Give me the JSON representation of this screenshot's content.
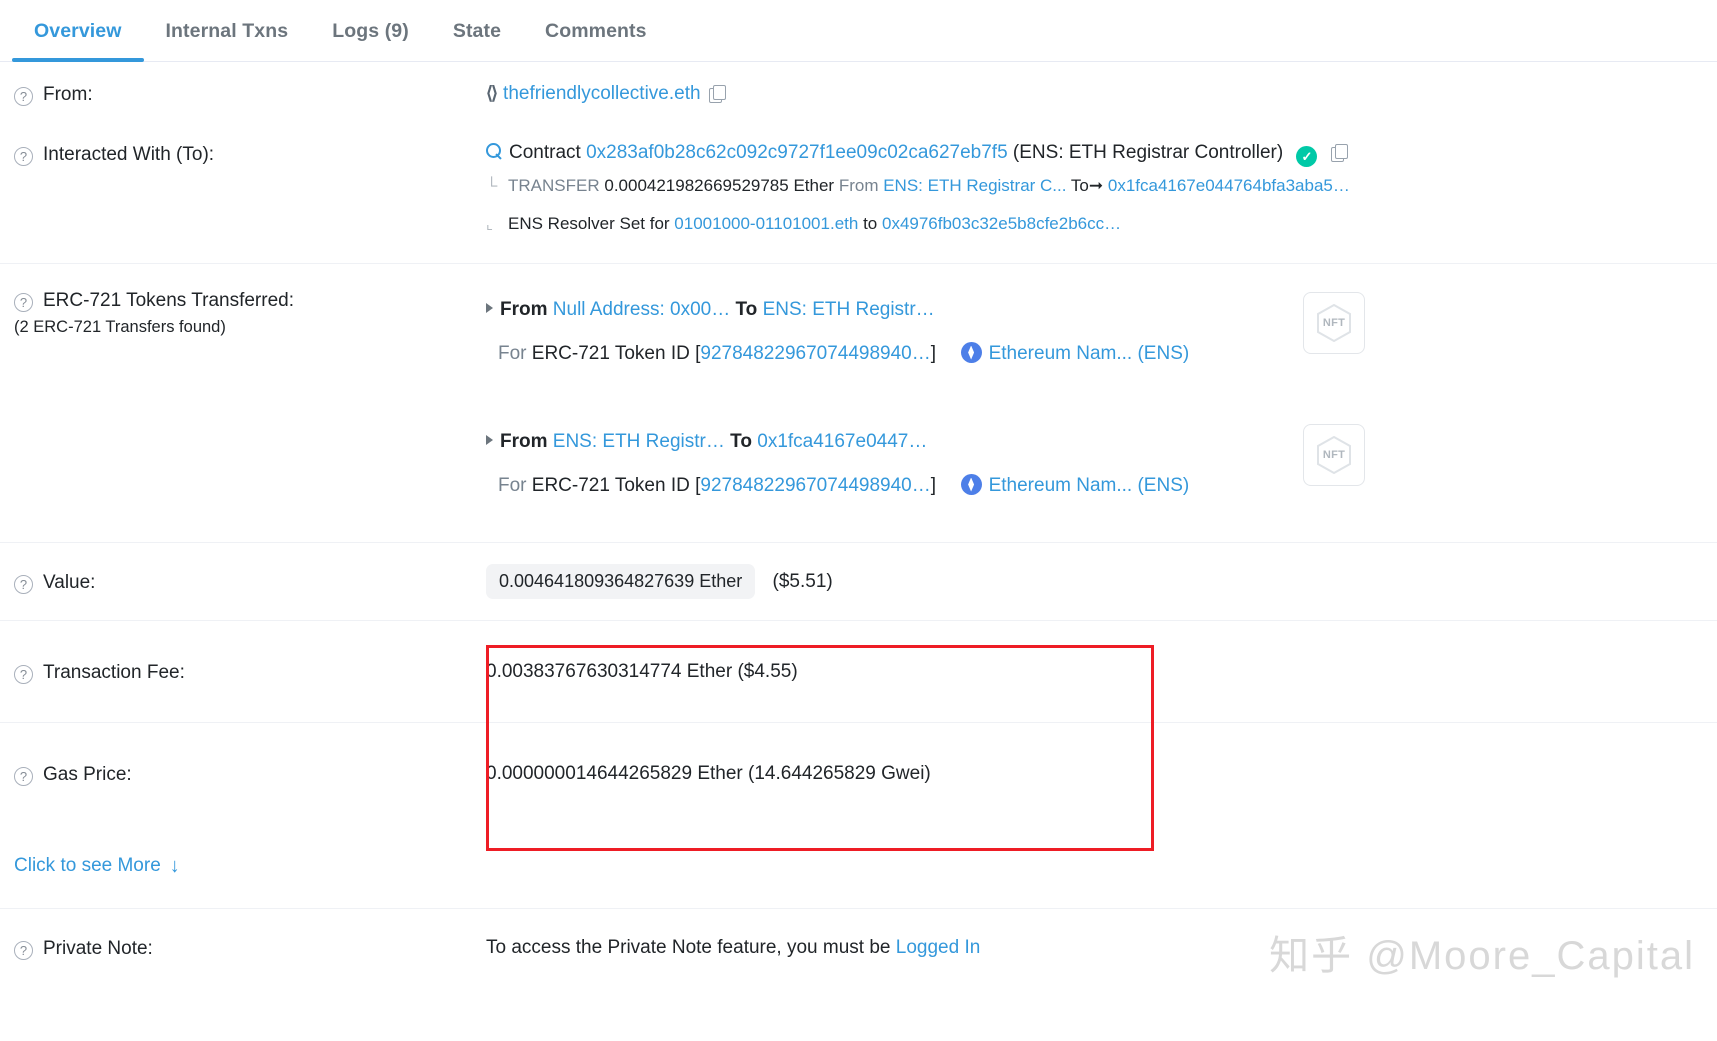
{
  "tabs": [
    {
      "label": "Overview",
      "active": true
    },
    {
      "label": "Internal Txns",
      "active": false
    },
    {
      "label": "Logs (9)",
      "active": false
    },
    {
      "label": "State",
      "active": false
    },
    {
      "label": "Comments",
      "active": false
    }
  ],
  "from": {
    "label": "From:",
    "icon": "ens-brackets-icon",
    "ens_name": "thefriendlycollective.eth",
    "copy_icon": "copy-icon",
    "help_icon": "question-mark-icon"
  },
  "interacted_with": {
    "label": "Interacted With (To):",
    "search_icon": "magnifier-icon",
    "contract_word": "Contract",
    "address": "0x283af0b28c62c092c9727f1ee09c02ca627eb7f5",
    "tag": "(ENS: ETH Registrar Controller)",
    "verified_icon": "verified-check-icon",
    "copy_icon": "copy-icon",
    "transfer": {
      "corner": "└",
      "keyword": "TRANSFER",
      "amount": "0.000421982669529785 Ether",
      "from_word": "From",
      "from_name": "ENS: ETH Registrar C...",
      "to_word": "To",
      "arrow": "➞",
      "to_address": "0x1fca4167e044764bfa3aba5…"
    },
    "resolver": {
      "corner": "⌞",
      "prefix": "ENS Resolver Set for",
      "name": "01001000-01101001.eth",
      "middle": "to",
      "address": "0x4976fb03c32e5b8cfe2b6cc…"
    }
  },
  "erc721": {
    "label": "ERC-721 Tokens Transferred:",
    "sublabel": "(2 ERC-721 Transfers found)",
    "transfers": [
      {
        "from_word": "From",
        "from": "Null Address: 0x00…",
        "to_word": "To",
        "to": "ENS: ETH Registr…",
        "for_word": "For",
        "token_std": "ERC-721 Token ID",
        "token_id": "92784822967074498940…",
        "token_name": "Ethereum Nam... (ENS)",
        "thumb_label": "NFT"
      },
      {
        "from_word": "From",
        "from": "ENS: ETH Registr…",
        "to_word": "To",
        "to": "0x1fca4167e0447…",
        "for_word": "For",
        "token_std": "ERC-721 Token ID",
        "token_id": "92784822967074498940…",
        "token_name": "Ethereum Nam... (ENS)",
        "thumb_label": "NFT"
      }
    ]
  },
  "value": {
    "label": "Value:",
    "amount": "0.004641809364827639 Ether",
    "fiat": "($5.51)"
  },
  "transaction_fee": {
    "label": "Transaction Fee:",
    "text": "0.00383767630314774 Ether ($4.55)"
  },
  "gas_price": {
    "label": "Gas Price:",
    "text": "0.000000014644265829 Ether (14.644265829 Gwei)"
  },
  "see_more": {
    "label": "Click to see More",
    "arrow": "↓"
  },
  "private_note": {
    "label": "Private Note:",
    "text": "To access the Private Note feature, you must be",
    "link": "Logged In"
  },
  "watermark": {
    "zh": "知乎",
    "handle": "@Moore_Capital"
  },
  "colors": {
    "link": "#3498db",
    "highlight": "#ee1d25",
    "verified": "#00c9a7",
    "muted": "#77838f"
  }
}
